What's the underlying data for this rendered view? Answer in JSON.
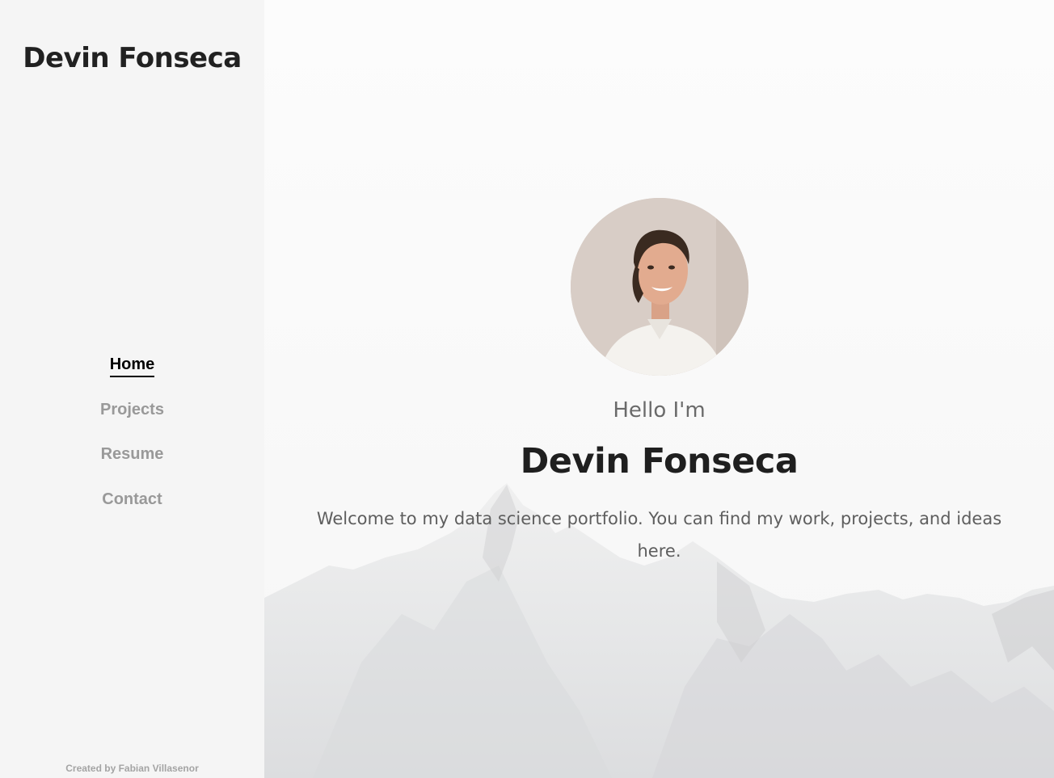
{
  "sidebar": {
    "title": "Devin Fonseca",
    "nav": [
      {
        "label": "Home",
        "active": true
      },
      {
        "label": "Projects",
        "active": false
      },
      {
        "label": "Resume",
        "active": false
      },
      {
        "label": "Contact",
        "active": false
      }
    ],
    "credit": "Created by Fabian Villasenor"
  },
  "hero": {
    "greeting": "Hello I'm",
    "name": "Devin Fonseca",
    "welcome": "Welcome to my data science portfolio. You can find my work, projects, and ideas here."
  },
  "colors": {
    "sidebar_bg": "#f5f5f5",
    "nav_active": "#000000",
    "nav_inactive": "#999999",
    "title_text": "#212121"
  }
}
